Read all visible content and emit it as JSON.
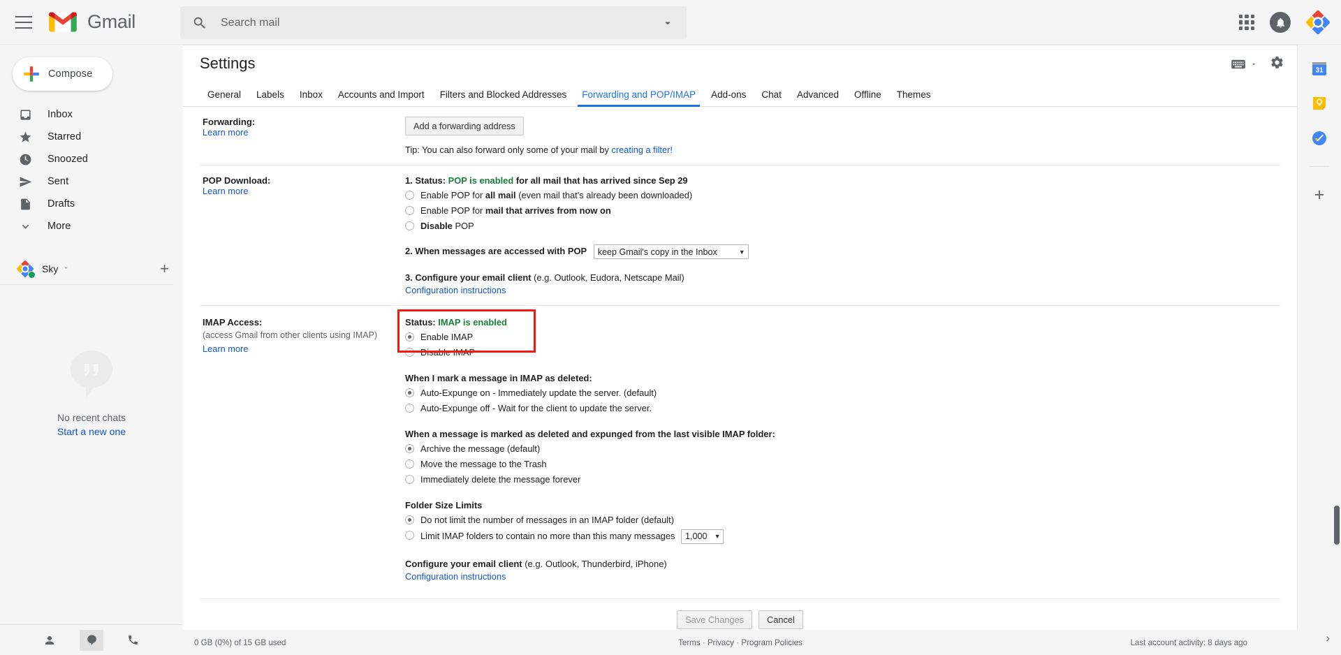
{
  "app": {
    "brand": "Gmail",
    "menu_icon": "hamburger-icon"
  },
  "search": {
    "placeholder": "Search mail",
    "value": ""
  },
  "compose": {
    "label": "Compose"
  },
  "sidebar": {
    "items": [
      {
        "label": "Inbox",
        "icon": "inbox-icon"
      },
      {
        "label": "Starred",
        "icon": "star-icon"
      },
      {
        "label": "Snoozed",
        "icon": "clock-icon"
      },
      {
        "label": "Sent",
        "icon": "send-icon"
      },
      {
        "label": "Drafts",
        "icon": "draft-icon"
      },
      {
        "label": "More",
        "icon": "chevron-down-icon"
      }
    ],
    "chat": {
      "name": "Sky",
      "status": "online",
      "empty_text": "No recent chats",
      "empty_link": "Start a new one"
    }
  },
  "settings": {
    "title": "Settings",
    "tabs": [
      {
        "label": "General",
        "active": false
      },
      {
        "label": "Labels",
        "active": false
      },
      {
        "label": "Inbox",
        "active": false
      },
      {
        "label": "Accounts and Import",
        "active": false
      },
      {
        "label": "Filters and Blocked Addresses",
        "active": false
      },
      {
        "label": "Forwarding and POP/IMAP",
        "active": true
      },
      {
        "label": "Add-ons",
        "active": false
      },
      {
        "label": "Chat",
        "active": false
      },
      {
        "label": "Advanced",
        "active": false
      },
      {
        "label": "Offline",
        "active": false
      },
      {
        "label": "Themes",
        "active": false
      }
    ]
  },
  "forwarding": {
    "label": "Forwarding:",
    "learn_more": "Learn more",
    "add_button": "Add a forwarding address",
    "tip_prefix": "Tip: You can also forward only some of your mail by ",
    "tip_link": "creating a filter!"
  },
  "pop": {
    "label": "POP Download:",
    "learn_more": "Learn more",
    "status_prefix": "1. Status: ",
    "status_value": "POP is enabled",
    "status_suffix": " for all mail that has arrived since Sep 29",
    "options": [
      {
        "pre": "Enable POP for ",
        "bold": "all mail",
        "post": " (even mail that's already been downloaded)",
        "checked": false
      },
      {
        "pre": "Enable POP for ",
        "bold": "mail that arrives from now on",
        "post": "",
        "checked": false
      },
      {
        "pre": "",
        "bold": "Disable",
        "post": " POP",
        "checked": false
      }
    ],
    "access_label": "2. When messages are accessed with POP",
    "access_value": "keep Gmail's copy in the Inbox",
    "configure_bold": "3. Configure your email client",
    "configure_rest": " (e.g. Outlook, Eudora, Netscape Mail)",
    "configure_link": "Configuration instructions"
  },
  "imap": {
    "label": "IMAP Access:",
    "sub": "(access Gmail from other clients using IMAP)",
    "learn_more": "Learn more",
    "status_prefix": "Status: ",
    "status_value": "IMAP is enabled",
    "enable_label": "Enable IMAP",
    "disable_label": "Disable IMAP",
    "enable_checked": true,
    "disable_checked": false,
    "highlight_color": "#f21b0d",
    "expunge_title": "When I mark a message in IMAP as deleted:",
    "expunge_options": [
      {
        "label": "Auto-Expunge on - Immediately update the server. (default)",
        "checked": true
      },
      {
        "label": "Auto-Expunge off - Wait for the client to update the server.",
        "checked": false
      }
    ],
    "deleted_title": "When a message is marked as deleted and expunged from the last visible IMAP folder:",
    "deleted_options": [
      {
        "label": "Archive the message (default)",
        "checked": true
      },
      {
        "label": "Move the message to the Trash",
        "checked": false
      },
      {
        "label": "Immediately delete the message forever",
        "checked": false
      }
    ],
    "folder_title": "Folder Size Limits",
    "folder_options": [
      {
        "label": "Do not limit the number of messages in an IMAP folder (default)",
        "checked": true
      },
      {
        "label": "Limit IMAP folders to contain no more than this many messages",
        "checked": false
      }
    ],
    "folder_limit_value": "1,000",
    "configure_bold": "Configure your email client",
    "configure_rest": " (e.g. Outlook, Thunderbird, iPhone)",
    "configure_link": "Configuration instructions"
  },
  "actions": {
    "save": "Save Changes",
    "cancel": "Cancel",
    "save_disabled": true
  },
  "footer": {
    "storage": "0 GB (0%) of 15 GB used",
    "terms": "Terms",
    "privacy": "Privacy",
    "policies": "Program Policies",
    "sep": " · ",
    "activity": "Last account activity: 8 days ago"
  },
  "rail": {
    "calendar_day": "31",
    "items": [
      "calendar-icon",
      "keep-icon",
      "tasks-icon"
    ],
    "add": "+"
  },
  "colors": {
    "accent": "#1a73e8",
    "link": "#1155cc",
    "green": "#188038",
    "red_highlight": "#f21b0d"
  }
}
